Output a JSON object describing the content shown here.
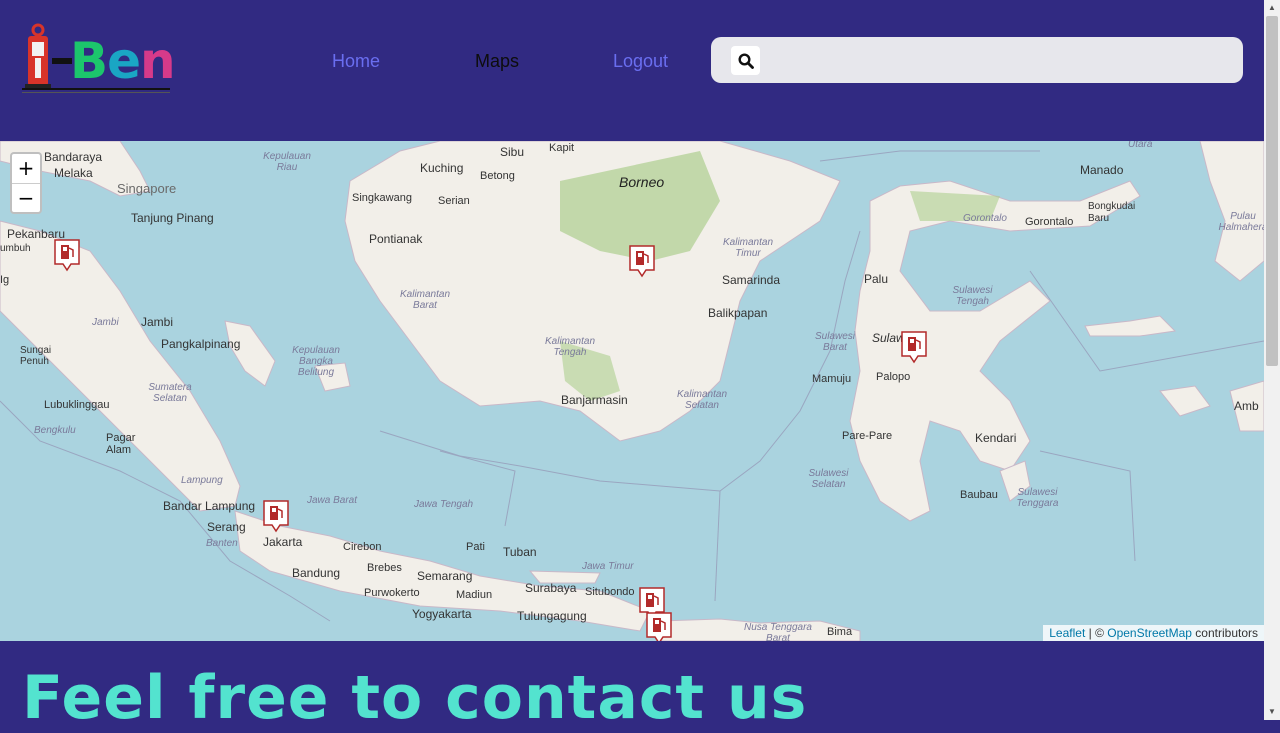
{
  "brand": {
    "logo_letter": "i",
    "logo_text_b": "B",
    "logo_text_e": "e",
    "logo_text_n": "n"
  },
  "nav": {
    "home": "Home",
    "maps": "Maps",
    "logout": "Logout"
  },
  "search": {
    "value": "",
    "placeholder": ""
  },
  "map": {
    "zoom_in": "+",
    "zoom_out": "−",
    "attribution_leaflet": "Leaflet",
    "attribution_sep": " | © ",
    "attribution_osm": "OpenStreetMap",
    "attribution_tail": " contributors",
    "labels": [
      "Bandaraya",
      "Melaka",
      "Singapore",
      "Tanjung Pinang",
      "Pekanbaru",
      "umbuh",
      "Kuching",
      "Sibu",
      "Kapit",
      "Betong",
      "Singkawang",
      "Serian",
      "Pontianak",
      "Borneo",
      "Samarinda",
      "Balikpapan",
      "Banjarmasin",
      "Jambi",
      "Pangkalpinang",
      "Sungai Penuh",
      "Lubuklinggau",
      "Pagar Alam",
      "Bandar Lampung",
      "Serang",
      "Jakarta",
      "Bandung",
      "Cirebon",
      "Brebes",
      "Purwokerto",
      "Semarang",
      "Pati",
      "Tuban",
      "Surabaya",
      "Situbondo",
      "Madiun",
      "Yogyakarta",
      "Tulungagung",
      "Bima",
      "Manado",
      "Gorontalo",
      "Bongkudai Baru",
      "Palu",
      "Palopo",
      "Mamuju",
      "Pare-Pare",
      "Kendari",
      "Baubau",
      "Sulaw",
      "Amb",
      "Ig"
    ],
    "region_labels": [
      "Kepulauan Riau",
      "Kalimantan Barat",
      "Kalimantan Timur",
      "Kalimantan Tengah",
      "Kalimantan Selatan",
      "Kepulauan Bangka Belitung",
      "Sumatera Selatan",
      "Bengkulu",
      "Jambi",
      "Lampung",
      "Banten",
      "Jawa Barat",
      "Jawa Tengah",
      "Jawa Timur",
      "Nusa Tenggara Barat",
      "Sulawesi Barat",
      "Sulawesi Tengah",
      "Sulawesi Selatan",
      "Sulawesi Tenggara",
      "Gorontalo",
      "Utara",
      "Pulau Halmahera",
      "Utara"
    ]
  },
  "markers": [
    "gas-station",
    "gas-station",
    "gas-station",
    "gas-station",
    "gas-station",
    "gas-station"
  ],
  "contact": {
    "heading": "Feel free to contact us"
  },
  "colors": {
    "navbar": "#312a82",
    "link": "#6a6ef0",
    "heading": "#53e3cf",
    "marker": "#b22a2a"
  }
}
